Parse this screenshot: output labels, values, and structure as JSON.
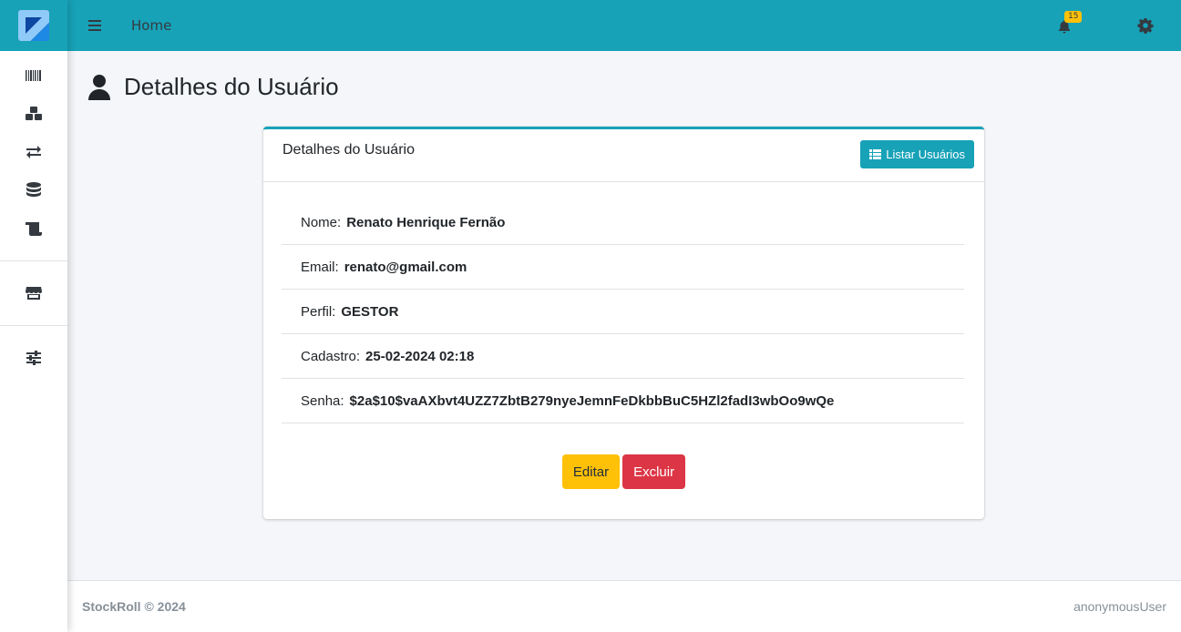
{
  "topbar": {
    "home_label": "Home",
    "notification_count": "15"
  },
  "page": {
    "title": "Detalhes do Usuário"
  },
  "card": {
    "title": "Detalhes do Usuário",
    "list_button_label": "Listar Usuários",
    "fields": [
      {
        "label": "Nome:",
        "value": "Renato Henrique Fernão"
      },
      {
        "label": "Email:",
        "value": "renato@gmail.com"
      },
      {
        "label": "Perfil:",
        "value": "GESTOR"
      },
      {
        "label": "Cadastro:",
        "value": "25-02-2024 02:18"
      },
      {
        "label": "Senha:",
        "value": "$2a$10$vaAXbvt4UZZ7ZbtB279nyeJemnFeDkbbBuC5HZl2fadI3wbOo9wQe"
      }
    ],
    "edit_label": "Editar",
    "delete_label": "Excluir"
  },
  "footer": {
    "copyright": "StockRoll © 2024",
    "user": "anonymousUser"
  },
  "colors": {
    "primary": "#17a2b8",
    "warning": "#ffc107",
    "danger": "#dc3545"
  },
  "sidebar_icons": [
    "barcode-icon",
    "boxes-icon",
    "exchange-icon",
    "database-icon",
    "scroll-icon",
    "store-icon",
    "sliders-icon"
  ]
}
